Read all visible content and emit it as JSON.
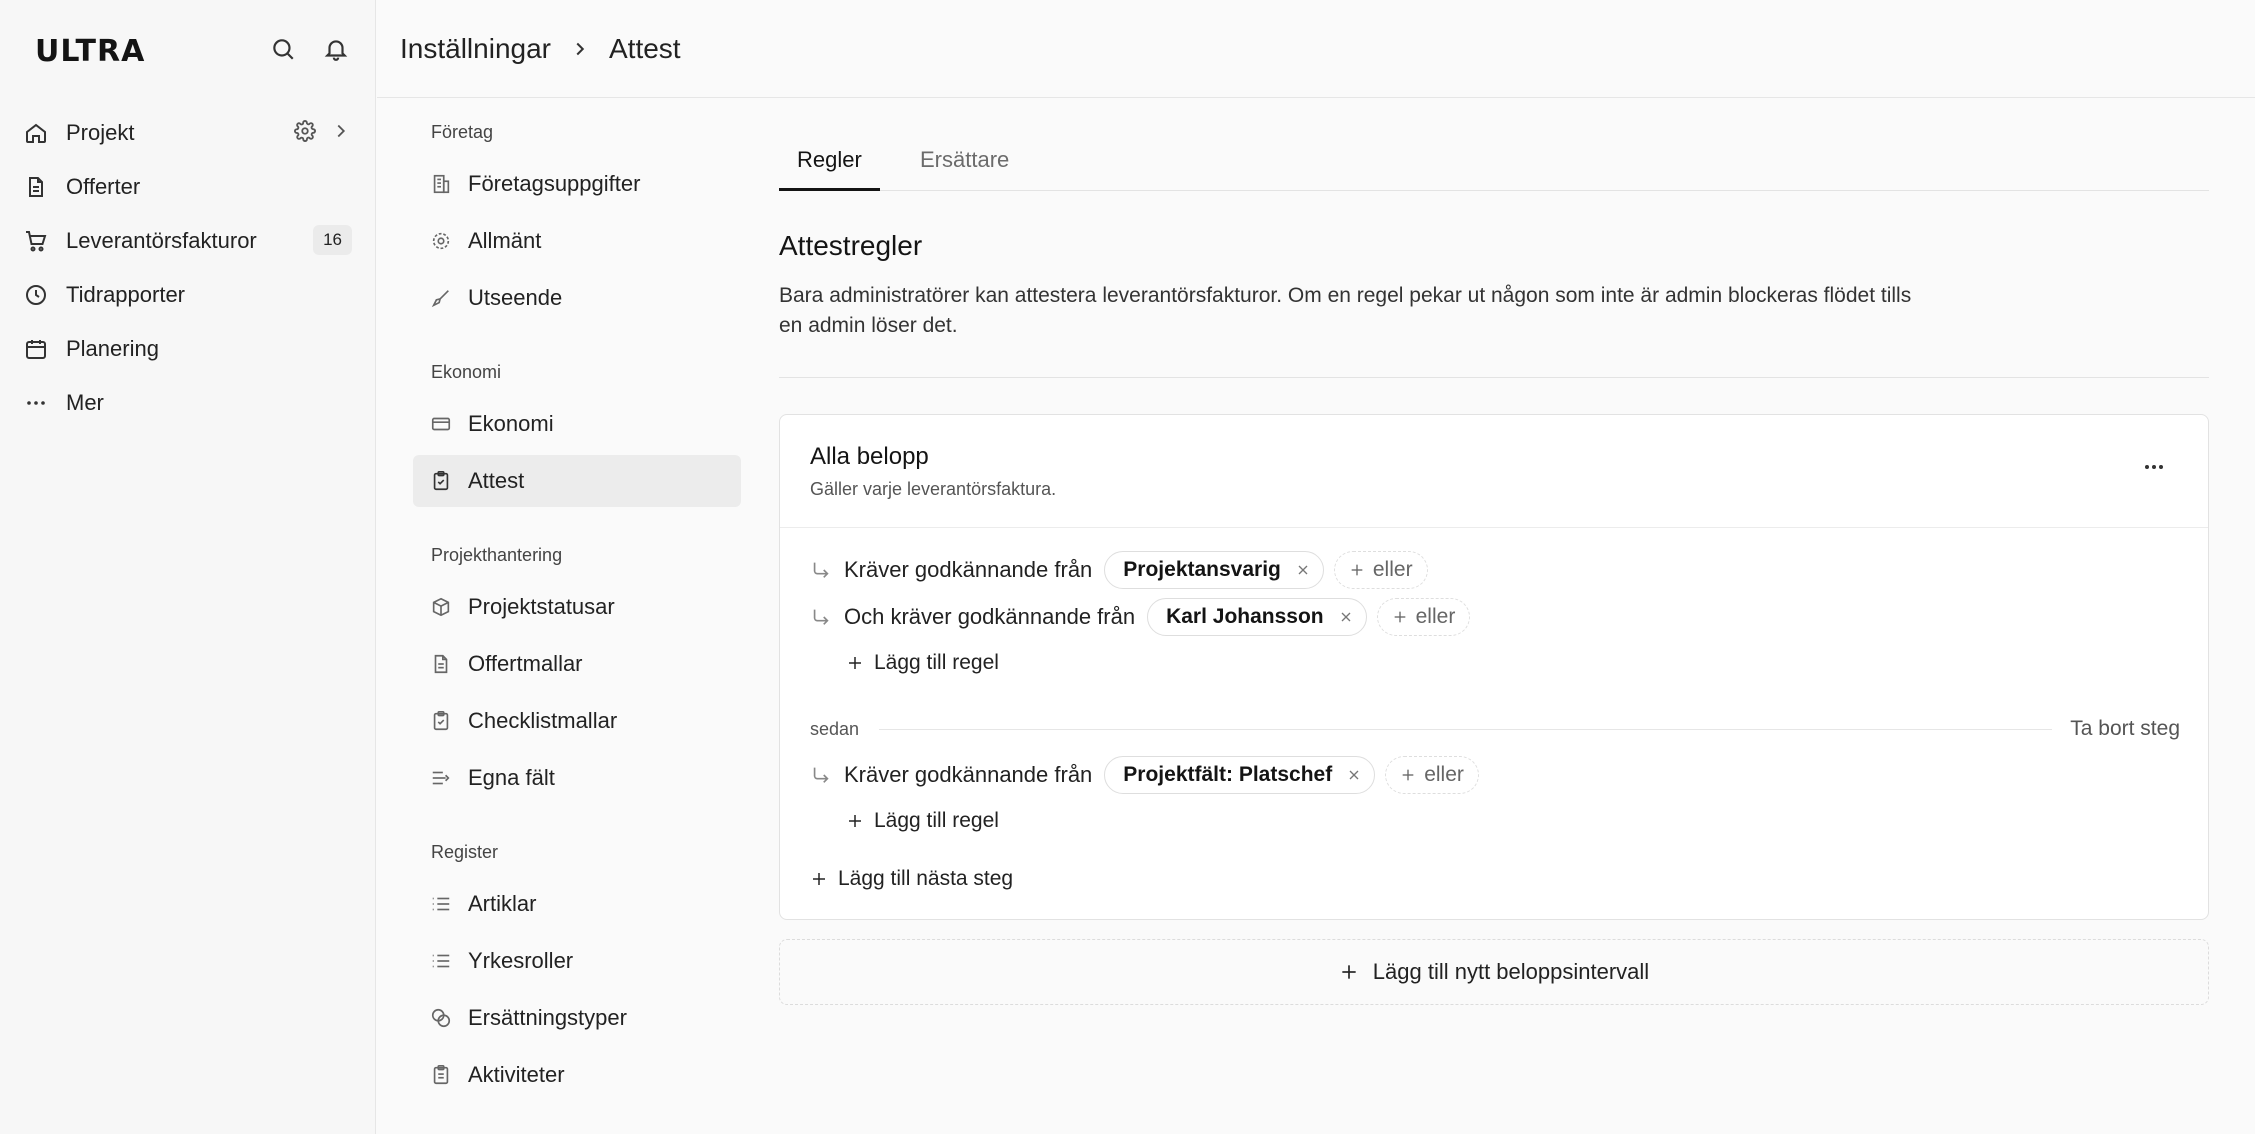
{
  "app": {
    "logo": "ULTRA"
  },
  "leftnav": {
    "items": [
      {
        "label": "Projekt",
        "icon": "home-icon"
      },
      {
        "label": "Offerter",
        "icon": "document-icon"
      },
      {
        "label": "Leverantörsfakturor",
        "icon": "cart-icon",
        "badge": "16"
      },
      {
        "label": "Tidrapporter",
        "icon": "clock-icon"
      },
      {
        "label": "Planering",
        "icon": "calendar-icon"
      },
      {
        "label": "Mer",
        "icon": "more-icon"
      }
    ]
  },
  "breadcrumb": {
    "root": "Inställningar",
    "current": "Attest"
  },
  "settings_menu": {
    "sections": [
      {
        "title": "Företag",
        "items": [
          "Företagsuppgifter",
          "Allmänt",
          "Utseende"
        ]
      },
      {
        "title": "Ekonomi",
        "items": [
          "Ekonomi",
          "Attest"
        ]
      },
      {
        "title": "Projekthantering",
        "items": [
          "Projektstatusar",
          "Offertmallar",
          "Checklistmallar",
          "Egna fält"
        ]
      },
      {
        "title": "Register",
        "items": [
          "Artiklar",
          "Yrkesroller",
          "Ersättningstyper",
          "Aktiviteter"
        ]
      }
    ],
    "active": "Attest"
  },
  "tabs": [
    {
      "label": "Regler",
      "active": true
    },
    {
      "label": "Ersättare",
      "active": false
    }
  ],
  "main": {
    "title": "Attestregler",
    "description": "Bara administratörer kan attestera leverantörsfakturor. Om en regel pekar ut någon som inte är admin blockeras flödet tills en admin löser det."
  },
  "card": {
    "title": "Alla belopp",
    "subtitle": "Gäller varje leverantörsfaktura.",
    "step1": {
      "rules": [
        {
          "text": "Kräver godkännande från",
          "chip": "Projektansvarig",
          "or": "eller"
        },
        {
          "text": "Och kräver godkännande från",
          "chip": "Karl Johansson",
          "or": "eller"
        }
      ],
      "add_rule": "Lägg till regel"
    },
    "then_label": "sedan",
    "remove_step": "Ta bort steg",
    "step2": {
      "rules": [
        {
          "text": "Kräver godkännande från",
          "chip": "Projektfält: Platschef",
          "or": "eller"
        }
      ],
      "add_rule": "Lägg till regel"
    },
    "add_next_step": "Lägg till nästa steg"
  },
  "add_interval": "Lägg till nytt beloppsintervall"
}
